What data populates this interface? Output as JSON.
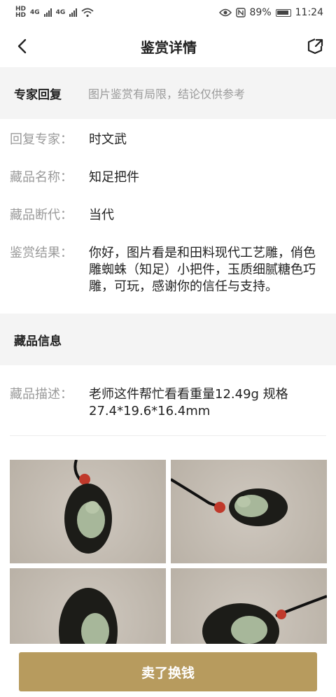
{
  "status_bar": {
    "left_labels": [
      "HD",
      "HD",
      "4G",
      "4G"
    ],
    "battery": "89%",
    "time": "11:24"
  },
  "nav": {
    "title": "鉴赏详情",
    "back_icon": "chevron-left-icon",
    "share_icon": "share-icon"
  },
  "expert_section": {
    "heading": "专家回复",
    "note": "图片鉴赏有局限，结论仅供参考"
  },
  "details": [
    {
      "label": "回复专家：",
      "value": "时文武"
    },
    {
      "label": "藏品名称：",
      "value": "知足把件"
    },
    {
      "label": "藏品断代：",
      "value": "当代"
    },
    {
      "label": "鉴赏结果：",
      "value": "你好，图片看是和田料现代工艺雕，俏色雕蜘蛛（知足）小把件，玉质细腻糖色巧雕，可玩，感谢你的信任与支持。"
    }
  ],
  "collection_section": {
    "heading": "藏品信息"
  },
  "description": {
    "label": "藏品描述：",
    "value": "老师这件帮忙看看重量12.49g 规格27.4*19.6*16.4mm"
  },
  "photos": [
    "photo-1",
    "photo-2",
    "photo-3",
    "photo-4"
  ],
  "bottom": {
    "sell_label": "卖了换钱"
  },
  "colors": {
    "accent": "#b79b5e",
    "section_bg": "#f4f4f4",
    "muted_text": "#9a9a9a"
  }
}
